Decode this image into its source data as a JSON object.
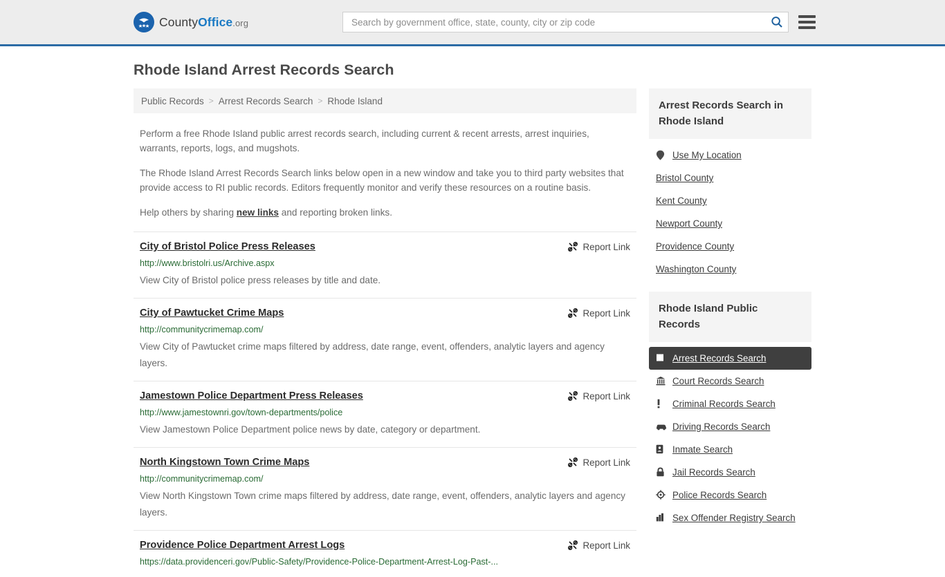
{
  "header": {
    "logo": {
      "icon": "eagle-stars-badge-icon",
      "text_part1": "County",
      "text_part2": "Office",
      "text_tld": ".org"
    },
    "search": {
      "placeholder": "Search by government office, state, county, city or zip code",
      "value": "",
      "search_icon": "search-icon"
    },
    "menu_icon": "hamburger-menu-icon",
    "accent_color": "#2c6ba5",
    "background_color": "#ededed"
  },
  "page_title": "Rhode Island Arrest Records Search",
  "breadcrumb": {
    "separator": ">",
    "items": [
      {
        "label": "Public Records"
      },
      {
        "label": "Arrest Records Search"
      },
      {
        "label": "Rhode Island"
      }
    ]
  },
  "intro": {
    "paragraph1": "Perform a free Rhode Island public arrest records search, including current & recent arrests, arrest inquiries, warrants, reports, logs, and mugshots.",
    "paragraph2": "The Rhode Island Arrest Records Search links below open in a new window and take you to third party websites that provide access to RI public records. Editors frequently monitor and verify these resources on a routine basis.",
    "paragraph3_before": "Help others by sharing ",
    "paragraph3_link": "new links",
    "paragraph3_after": " and reporting broken links."
  },
  "results": {
    "report_label": "Report Link",
    "report_icon": "broken-link-icon",
    "items": [
      {
        "title": "City of Bristol Police Press Releases",
        "url": "http://www.bristolri.us/Archive.aspx",
        "description": "View City of Bristol police press releases by title and date."
      },
      {
        "title": "City of Pawtucket Crime Maps",
        "url": "http://communitycrimemap.com/",
        "description": "View City of Pawtucket crime maps filtered by address, date range, event, offenders, analytic layers and agency layers."
      },
      {
        "title": "Jamestown Police Department Press Releases",
        "url": "http://www.jamestownri.gov/town-departments/police",
        "description": "View Jamestown Police Department police news by date, category or department."
      },
      {
        "title": "North Kingstown Town Crime Maps",
        "url": "http://communitycrimemap.com/",
        "description": "View North Kingstown Town crime maps filtered by address, date range, event, offenders, analytic layers and agency layers."
      },
      {
        "title": "Providence Police Department Arrest Logs",
        "url": "https://data.providenceri.gov/Public-Safety/Providence-Police-Department-Arrest-Log-Past-...",
        "description": ""
      }
    ]
  },
  "sidebar": {
    "section1": {
      "heading": "Arrest Records Search in Rhode Island",
      "items": [
        {
          "label": "Use My Location",
          "icon": "map-pin-icon",
          "has_icon": true
        },
        {
          "label": "Bristol County",
          "icon": "",
          "has_icon": false
        },
        {
          "label": "Kent County",
          "icon": "",
          "has_icon": false
        },
        {
          "label": "Newport County",
          "icon": "",
          "has_icon": false
        },
        {
          "label": "Providence County",
          "icon": "",
          "has_icon": false
        },
        {
          "label": "Washington County",
          "icon": "",
          "has_icon": false
        }
      ]
    },
    "section2": {
      "heading": "Rhode Island Public Records",
      "items": [
        {
          "label": "Arrest Records Search",
          "icon": "handcuffs-icon",
          "active": true
        },
        {
          "label": "Court Records Search",
          "icon": "courthouse-icon",
          "active": false
        },
        {
          "label": "Criminal Records Search",
          "icon": "exclamation-icon",
          "active": false
        },
        {
          "label": "Driving Records Search",
          "icon": "car-icon",
          "active": false
        },
        {
          "label": "Inmate Search",
          "icon": "id-badge-icon",
          "active": false
        },
        {
          "label": "Jail Records Search",
          "icon": "lock-icon",
          "active": false
        },
        {
          "label": "Police Records Search",
          "icon": "police-badge-icon",
          "active": false
        },
        {
          "label": "Sex Offender Registry Search",
          "icon": "buildings-icon",
          "active": false
        }
      ]
    },
    "active_background": "#3f3f3f",
    "heading_background": "#f4f4f4"
  }
}
